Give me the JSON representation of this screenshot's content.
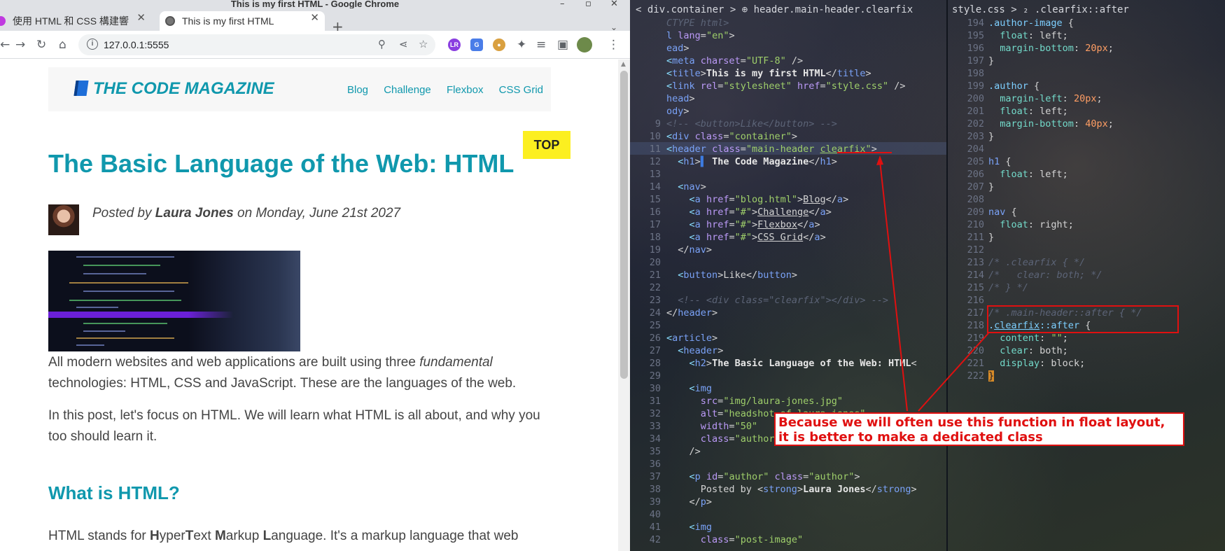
{
  "window": {
    "title": "This is my first HTML - Google Chrome"
  },
  "tabs": [
    {
      "label": "使用 HTML 和 CSS 構建響"
    },
    {
      "label": "This is my first HTML"
    }
  ],
  "address_bar": {
    "url": "127.0.0.1:5555"
  },
  "page": {
    "logo": "THE CODE MAGAZINE",
    "nav": [
      "Blog",
      "Challenge",
      "Flexbox",
      "CSS Grid"
    ],
    "top_button": "TOP",
    "title": "The Basic Language of the Web: HTML",
    "author_prefix": "Posted by",
    "author_name": "Laura Jones",
    "author_date": "on Monday, June 21st 2027",
    "para1_a": "All modern websites and web applications are built using three",
    "para1_em": "fundamental",
    "para1_b": "technologies: HTML, CSS and JavaScript. These are the languages of the web.",
    "para2": "In this post, let's focus on HTML. We will learn what HTML is all about, and why you too should learn it.",
    "h3": "What is HTML?",
    "para3_rest": "It's a markup language that web",
    "para3_letters": [
      "H",
      "yper",
      "T",
      "ext ",
      "M",
      "arkup ",
      "L",
      "anguage."
    ],
    "para3_prefix": "HTML stands for"
  },
  "editor": {
    "left_breadcrumb": "< div.container > ⊕ header.main-header.clearfix",
    "right_breadcrumb": "style.css > ₂ .clearfix::after",
    "annotation": [
      "Because we will often use this function in float layout,",
      "it is better to make a dedicated class"
    ]
  },
  "colors": {
    "accent": "#1098ad",
    "top_btn": "#fcef20",
    "annotation_red": "#e01010"
  },
  "icons": [
    "back-icon",
    "forward-icon",
    "reload-icon",
    "home-icon",
    "info-icon",
    "zoom-icon",
    "share-icon",
    "star-icon",
    "extensions-icon",
    "menu-icon"
  ]
}
